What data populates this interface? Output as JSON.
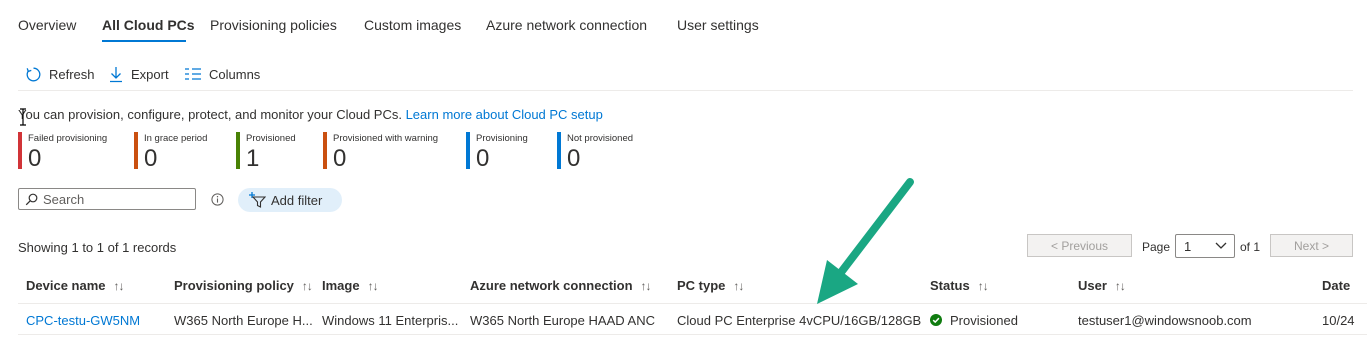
{
  "tabs": [
    {
      "label": "Overview",
      "active": false
    },
    {
      "label": "All Cloud PCs",
      "active": true
    },
    {
      "label": "Provisioning policies",
      "active": false
    },
    {
      "label": "Custom images",
      "active": false
    },
    {
      "label": "Azure network connection",
      "active": false
    },
    {
      "label": "User settings",
      "active": false
    }
  ],
  "toolbar": {
    "refresh_label": "Refresh",
    "export_label": "Export",
    "columns_label": "Columns"
  },
  "info": {
    "text": "You can provision, configure, protect, and monitor your Cloud PCs.",
    "link": "Learn more about Cloud PC setup"
  },
  "status_tiles": [
    {
      "label": "Failed provisioning",
      "count": "0",
      "color": "#d13438"
    },
    {
      "label": "In grace period",
      "count": "0",
      "color": "#ca5010"
    },
    {
      "label": "Provisioned",
      "count": "1",
      "color": "#498205"
    },
    {
      "label": "Provisioned with warning",
      "count": "0",
      "color": "#ca5010"
    },
    {
      "label": "Provisioning",
      "count": "0",
      "color": "#0078d4"
    },
    {
      "label": "Not provisioned",
      "count": "0",
      "color": "#0078d4"
    }
  ],
  "search": {
    "placeholder": "Search"
  },
  "filter": {
    "add_label": "Add filter"
  },
  "records": {
    "summary": "Showing 1 to 1 of 1 records"
  },
  "pager": {
    "previous_label": "< Previous",
    "page_label": "Page",
    "current_page": "1",
    "of_label": "of 1",
    "next_label": "Next >"
  },
  "table": {
    "sort_glyph": "↑↓",
    "columns": [
      "Device name",
      "Provisioning policy",
      "Image",
      "Azure network connection",
      "PC type",
      "Status",
      "User",
      "Date"
    ],
    "rows": [
      {
        "device_name": "CPC-testu-GW5NM",
        "provisioning_policy": "W365 North Europe H...",
        "image": "Windows 11 Enterpris...",
        "network_connection": "W365 North Europe HAAD ANC",
        "pc_type": "Cloud PC Enterprise 4vCPU/16GB/128GB",
        "status": "Provisioned",
        "user": "testuser1@windowsnoob.com",
        "date": "10/24"
      }
    ]
  },
  "colors": {
    "accent": "#0078d4",
    "annotation_arrow": "#1aa783",
    "status_success": "#107c10"
  }
}
